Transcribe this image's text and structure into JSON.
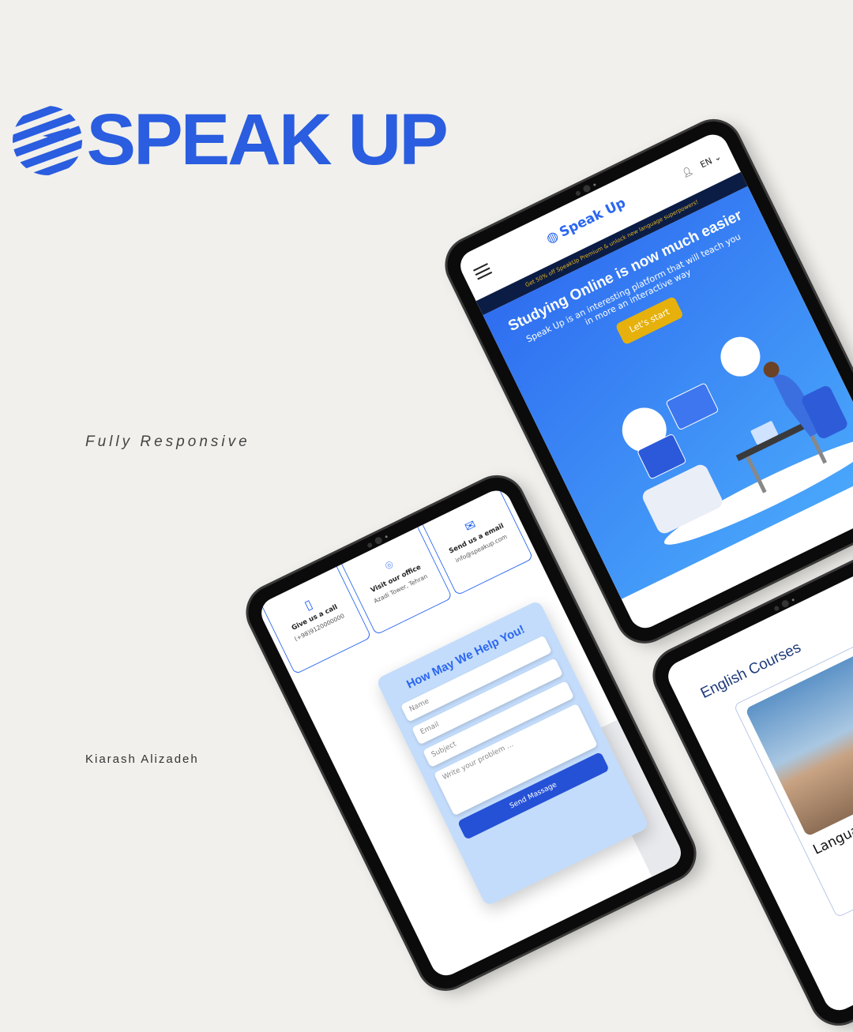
{
  "brand": {
    "name": "SPEAK UP",
    "color": "#2a5ddf"
  },
  "tagline": "Fully Responsive",
  "author": "Kiarash Alizadeh",
  "tablet_home": {
    "logo": "Speak Up",
    "language": "EN",
    "promo": "Get 50% off SpeakUp Premium & unlock new language superpowers!",
    "hero_title": "Studying Online is now much easier",
    "hero_subtitle": "Speak Up is an interesting platform that will teach you in more an interactive way",
    "cta": "Let's start"
  },
  "tablet_contact": {
    "cards": [
      {
        "title": "Give us a call",
        "detail": "(+98)9120000000",
        "icon": "phone-icon"
      },
      {
        "title": "Visit our office",
        "detail": "Azadi Tower, Tehran",
        "icon": "location-pin-icon"
      },
      {
        "title": "Send us a email",
        "detail": "info@speakup.com",
        "icon": "mail-icon"
      }
    ],
    "form_title": "How May We Help You!",
    "placeholders": {
      "name": "Name",
      "email": "Email",
      "subject": "Subject",
      "message": "Write your problem ..."
    },
    "send": "Send Massage"
  },
  "tablet_courses": {
    "heading": "English Courses",
    "course_title": "Languag"
  }
}
